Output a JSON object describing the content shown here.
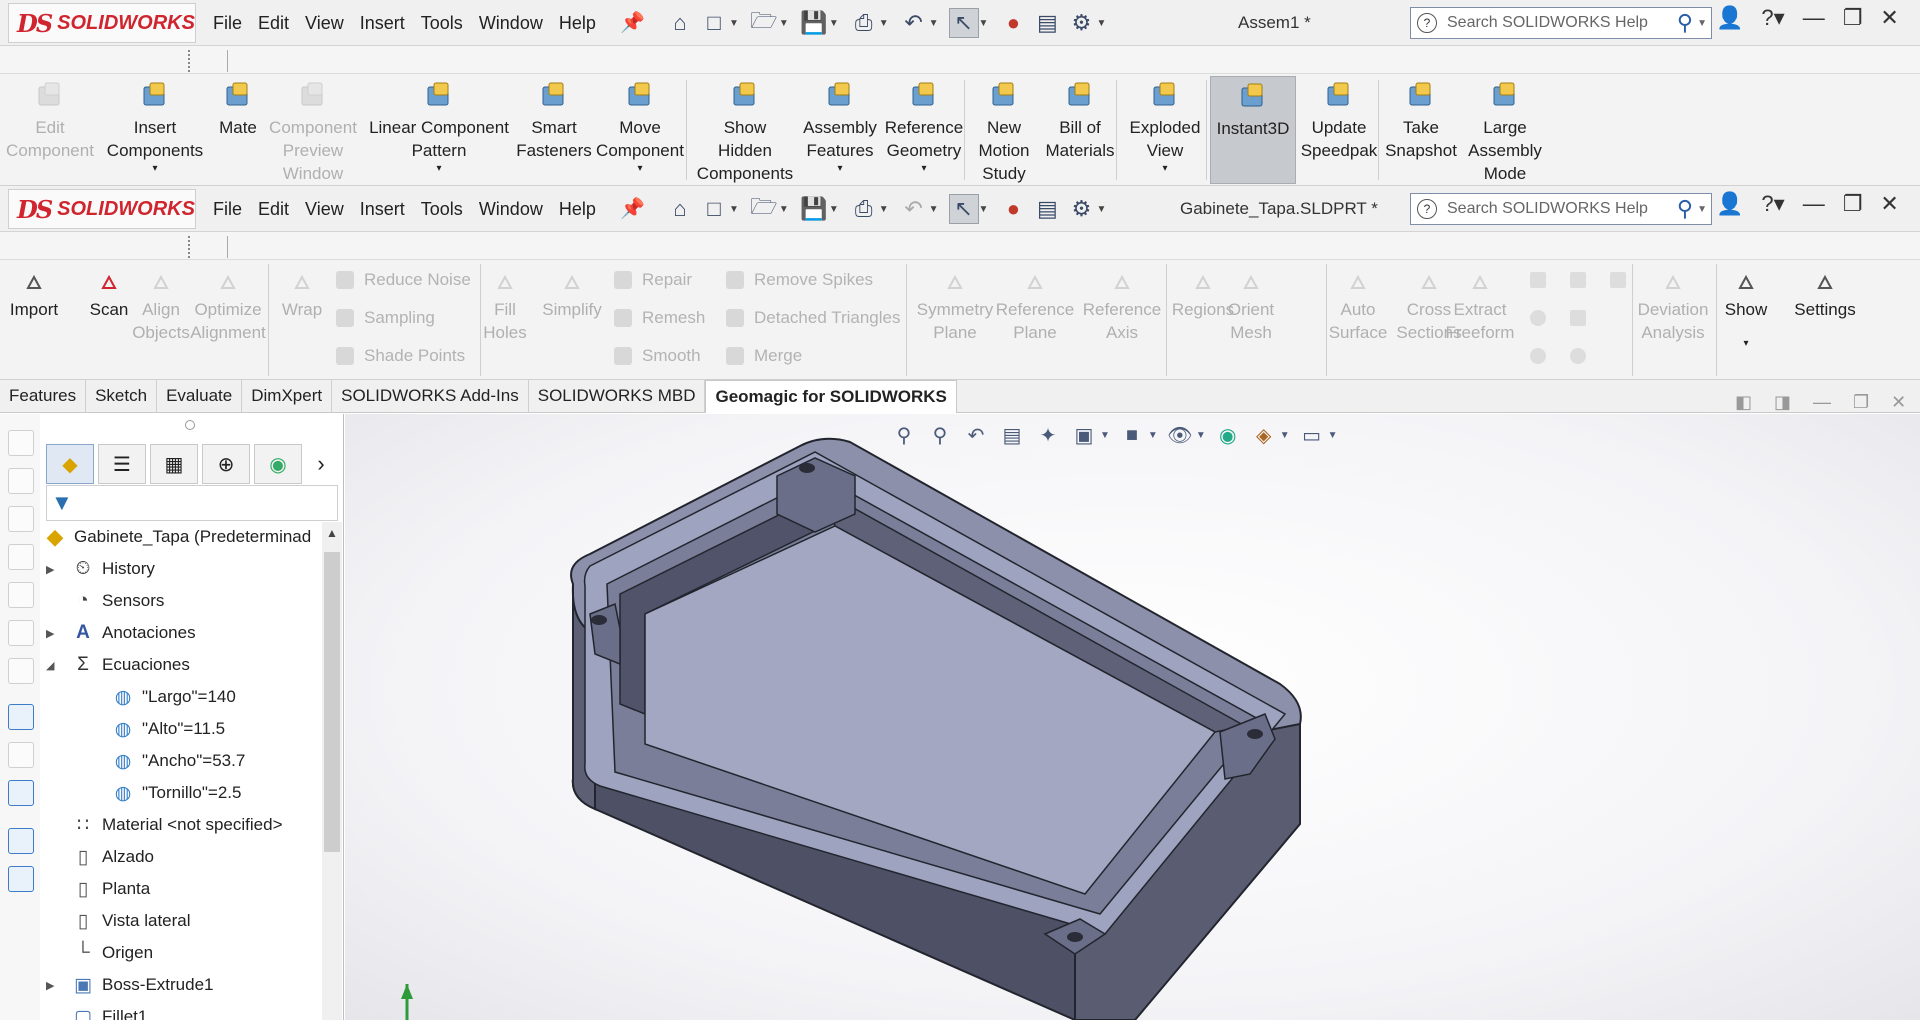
{
  "brand": {
    "ds": "DS",
    "name": "SOLIDWORKS"
  },
  "menus": [
    "File",
    "Edit",
    "View",
    "Insert",
    "Tools",
    "Window",
    "Help"
  ],
  "window1": {
    "title": "Assem1 *"
  },
  "window2": {
    "title": "Gabinete_Tapa.SLDPRT *"
  },
  "search": {
    "placeholder": "Search SOLIDWORKS Help"
  },
  "assembly_toolbar": [
    {
      "label": "Edit\nComponent",
      "disabled": true
    },
    {
      "label": "Insert\nComponents",
      "disabled": false
    },
    {
      "label": "Mate",
      "disabled": false
    },
    {
      "label": "Component\nPreview\nWindow",
      "disabled": true
    },
    {
      "label": "Linear Component\nPattern",
      "disabled": false
    },
    {
      "label": "Smart\nFasteners",
      "disabled": false
    },
    {
      "label": "Move\nComponent",
      "disabled": false
    },
    {
      "label": "Show\nHidden\nComponents",
      "disabled": false
    },
    {
      "label": "Assembly\nFeatures",
      "disabled": false
    },
    {
      "label": "Reference\nGeometry",
      "disabled": false
    },
    {
      "label": "New\nMotion\nStudy",
      "disabled": false
    },
    {
      "label": "Bill of\nMaterials",
      "disabled": false
    },
    {
      "label": "Exploded\nView",
      "disabled": false
    },
    {
      "label": "Instant3D",
      "disabled": false,
      "active": true
    },
    {
      "label": "Update\nSpeedpak",
      "disabled": false
    },
    {
      "label": "Take\nSnapshot",
      "disabled": false
    },
    {
      "label": "Large\nAssembly\nMode",
      "disabled": false
    }
  ],
  "geomagic_toolbar": {
    "big": [
      {
        "label": "Import",
        "disabled": false
      },
      {
        "label": "Scan",
        "disabled": false
      },
      {
        "label": "Align\nObjects",
        "disabled": true
      },
      {
        "label": "Optimize\nAlignment",
        "disabled": true
      },
      {
        "label": "Wrap",
        "disabled": true
      },
      {
        "label": "Fill\nHoles",
        "disabled": true
      },
      {
        "label": "Simplify",
        "disabled": true
      },
      {
        "label": "Symmetry\nPlane",
        "disabled": true
      },
      {
        "label": "Reference\nPlane",
        "disabled": true
      },
      {
        "label": "Reference\nAxis",
        "disabled": true
      },
      {
        "label": "Regions",
        "disabled": true
      },
      {
        "label": "Orient\nMesh",
        "disabled": true
      },
      {
        "label": "Auto\nSurface",
        "disabled": true
      },
      {
        "label": "Cross\nSections",
        "disabled": true
      },
      {
        "label": "Extract\nFreeform",
        "disabled": true
      },
      {
        "label": "Deviation\nAnalysis",
        "disabled": true
      },
      {
        "label": "Show",
        "disabled": false
      },
      {
        "label": "Settings",
        "disabled": false
      }
    ],
    "small": [
      "Reduce Noise",
      "Sampling",
      "Shade Points",
      "Repair",
      "Remesh",
      "Smooth",
      "Remove Spikes",
      "Detached Triangles",
      "Merge"
    ]
  },
  "tabs": [
    "Features",
    "Sketch",
    "Evaluate",
    "DimXpert",
    "SOLIDWORKS Add-Ins",
    "SOLIDWORKS MBD",
    "Geomagic for SOLIDWORKS"
  ],
  "active_tab": "Geomagic for SOLIDWORKS",
  "tree": {
    "root": "Gabinete_Tapa  (Predeterminad",
    "items": [
      {
        "label": "History",
        "icon": "history-icon",
        "expand": "collapsed",
        "indent": 1
      },
      {
        "label": "Sensors",
        "icon": "sensor-icon",
        "expand": "none",
        "indent": 1
      },
      {
        "label": "Anotaciones",
        "icon": "annotation-icon",
        "expand": "collapsed",
        "indent": 1
      },
      {
        "label": "Ecuaciones",
        "icon": "equation-icon",
        "expand": "expanded",
        "indent": 1
      },
      {
        "label": "\"Largo\"=140",
        "icon": "global-variable-icon",
        "expand": "none",
        "indent": 2
      },
      {
        "label": "\"Alto\"=11.5",
        "icon": "global-variable-icon",
        "expand": "none",
        "indent": 2
      },
      {
        "label": "\"Ancho\"=53.7",
        "icon": "global-variable-icon",
        "expand": "none",
        "indent": 2
      },
      {
        "label": "\"Tornillo\"=2.5",
        "icon": "global-variable-icon",
        "expand": "none",
        "indent": 2
      },
      {
        "label": "Material <not specified>",
        "icon": "material-icon",
        "expand": "none",
        "indent": 1
      },
      {
        "label": "Alzado",
        "icon": "plane-icon",
        "expand": "none",
        "indent": 1
      },
      {
        "label": "Planta",
        "icon": "plane-icon",
        "expand": "none",
        "indent": 1
      },
      {
        "label": "Vista lateral",
        "icon": "plane-icon",
        "expand": "none",
        "indent": 1
      },
      {
        "label": "Origen",
        "icon": "origin-icon",
        "expand": "none",
        "indent": 1
      },
      {
        "label": "Boss-Extrude1",
        "icon": "extrude-icon",
        "expand": "collapsed",
        "indent": 1
      },
      {
        "label": "Fillet1",
        "icon": "fillet-icon",
        "expand": "none",
        "indent": 1
      }
    ]
  },
  "colors": {
    "brand_red": "#d0252e",
    "model_face": "#9ea3bf",
    "model_dark": "#4e5166",
    "model_mid": "#6e7290"
  }
}
